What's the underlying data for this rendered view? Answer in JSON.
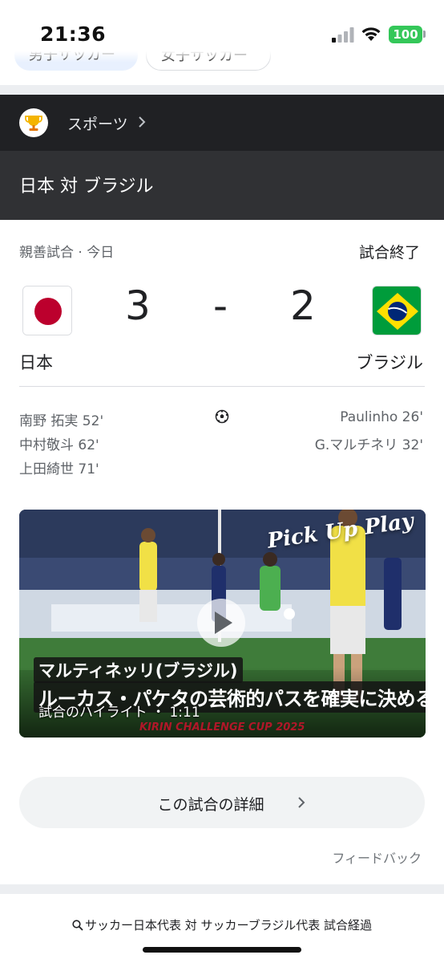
{
  "status_bar": {
    "time": "21:36",
    "battery": "100",
    "icons": [
      "signal-icon",
      "wifi-icon",
      "battery-icon"
    ]
  },
  "filter_chips": [
    "男子サッカー",
    "女子サッカー"
  ],
  "sports_header": {
    "label": "スポーツ",
    "icon": "trophy-icon"
  },
  "match": {
    "title": "日本 対 ブラジル",
    "competition": "親善試合 · 今日",
    "status": "試合終了",
    "home": {
      "name": "日本",
      "score": "3",
      "flag": "japan-flag"
    },
    "separator": "-",
    "away": {
      "name": "ブラジル",
      "score": "2",
      "flag": "brazil-flag"
    },
    "home_scorers": [
      "南野 拓実 52'",
      "中村敬斗 62'",
      "上田綺世 71'"
    ],
    "away_scorers": [
      "Paulinho 26'",
      "G.マルチネリ 32'"
    ]
  },
  "video": {
    "caption_name": "マルティネッリ(ブラジル)",
    "caption_text": "ルーカス・パケタの芸術的パスを確実に決める",
    "info": "試合のハイライト ・ 1:11",
    "overlay": "Pick Up Play",
    "sponsor": "KIRIN CHALLENGE CUP 2025"
  },
  "details_button": "この試合の詳細",
  "feedback": "フィードバック",
  "related_search": "サッカー日本代表 対 サッカーブラジル代表 試合経過",
  "colors": {
    "dark_header": "#202124",
    "title_bar": "#303134",
    "battery": "#34c759",
    "chip_active": "#e8f0fe"
  }
}
